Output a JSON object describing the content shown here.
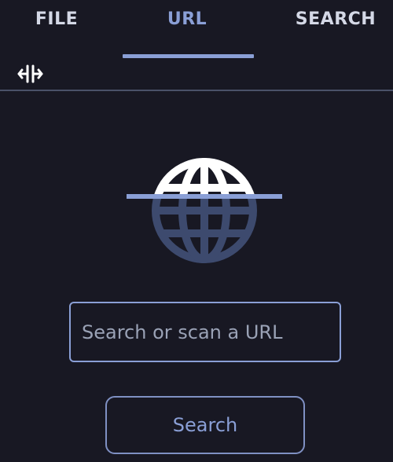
{
  "tabs": [
    {
      "label": "FILE",
      "active": false
    },
    {
      "label": "URL",
      "active": true
    },
    {
      "label": "SEARCH",
      "active": false
    }
  ],
  "toolbar": {
    "icon": "split-arrows-icon"
  },
  "scan_graphic": {
    "icon": "globe-scan-icon"
  },
  "url_input": {
    "value": "",
    "placeholder": "Search or scan a URL"
  },
  "search_button": {
    "label": "Search"
  },
  "colors": {
    "background": "#181823",
    "accent": "#8a9fd6",
    "tab_text": "#d4d8e6",
    "divider": "#4a5168",
    "globe_dim": "#3d4a6e"
  }
}
